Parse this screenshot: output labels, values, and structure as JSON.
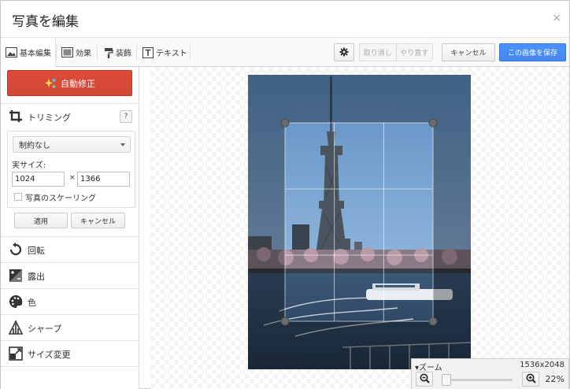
{
  "window": {
    "title": "写真を編集",
    "close": "×"
  },
  "toolbar": {
    "tabs": [
      {
        "label": "基本編集",
        "icon": "photo-icon"
      },
      {
        "label": "効果",
        "icon": "effects-icon"
      },
      {
        "label": "装飾",
        "icon": "paint-roller-icon"
      },
      {
        "label": "テキスト",
        "icon": "text-icon"
      }
    ],
    "settings_icon": "gear-icon",
    "undo_label": "取り消し",
    "redo_label": "やり直す",
    "cancel_label": "キャンセル",
    "save_label": "この画像を保存"
  },
  "sidebar": {
    "auto_fix_label": "自動修正",
    "crop": {
      "title": "トリミング",
      "help": "?",
      "ratio_option": "制約なし",
      "size_label": "実サイズ:",
      "width_value": "1024",
      "times_symbol": "×",
      "height_value": "1366",
      "scale_label": "写真のスケーリング",
      "scale_checked": false,
      "apply_label": "適用",
      "cancel_label": "キャンセル"
    },
    "sections": [
      {
        "label": "回転",
        "icon": "rotate-icon"
      },
      {
        "label": "露出",
        "icon": "exposure-icon"
      },
      {
        "label": "色",
        "icon": "palette-icon"
      },
      {
        "label": "シャープ",
        "icon": "sharpen-icon"
      },
      {
        "label": "サイズ変更",
        "icon": "resize-icon"
      }
    ]
  },
  "zoom": {
    "label": "▾ズーム",
    "dimensions": "1536x2048",
    "percent": "22%",
    "level": 0.05
  },
  "colors": {
    "accent_blue": "#4d90fe",
    "autofix_red": "#dd4b39"
  }
}
